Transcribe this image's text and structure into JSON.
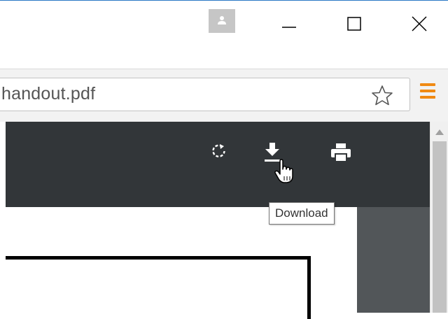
{
  "window": {
    "controls": {
      "minimize": "minimize",
      "maximize": "maximize",
      "close": "close"
    },
    "title_bar_accent": "#2b78c5"
  },
  "address_bar": {
    "url": "handout.pdf",
    "bookmark_icon": "star-outline-icon",
    "menu_icon": "hamburger-menu-icon",
    "menu_color": "#f08a13"
  },
  "pdf_toolbar": {
    "background": "#323639",
    "buttons": [
      "rotate",
      "download",
      "print"
    ]
  },
  "tooltip": {
    "text": "Download"
  }
}
